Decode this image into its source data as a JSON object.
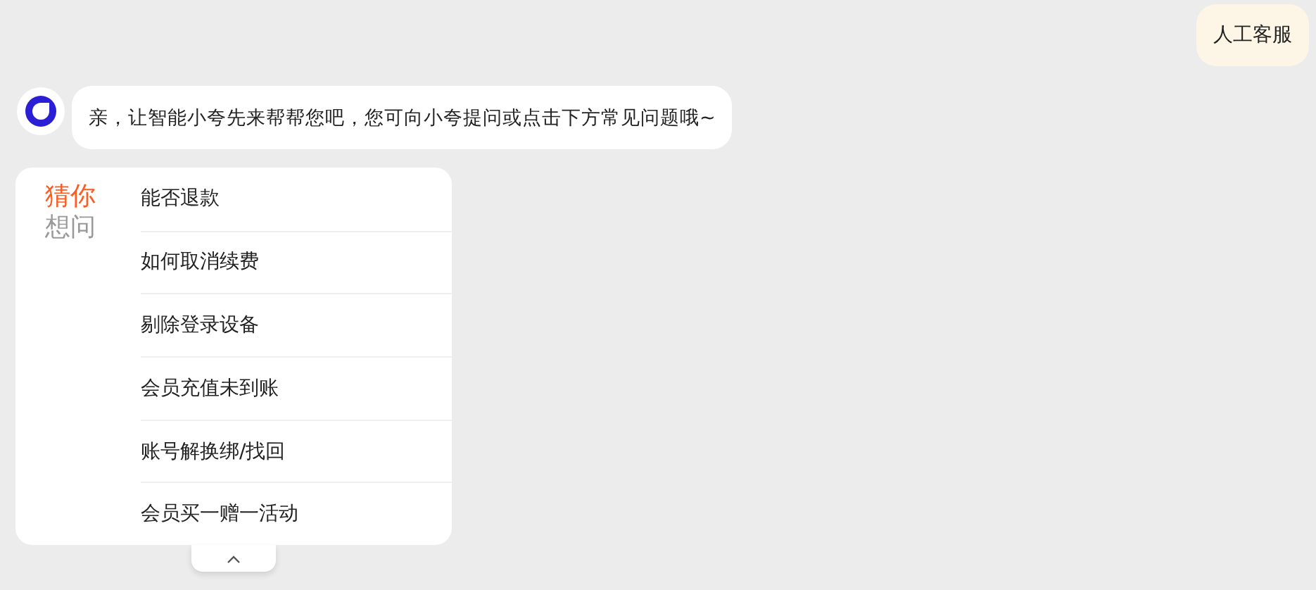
{
  "user_message": {
    "text": "人工客服"
  },
  "bot_message": {
    "text": "亲，让智能小夸先来帮帮您吧，您可向小夸提问或点击下方常见问题哦~"
  },
  "faq_card": {
    "title_top": "猜你",
    "title_bottom": "想问",
    "questions": [
      "能否退款",
      "如何取消续费",
      "剔除登录设备",
      "会员充值未到账",
      "账号解换绑/找回",
      "会员买一赠一活动"
    ]
  }
}
